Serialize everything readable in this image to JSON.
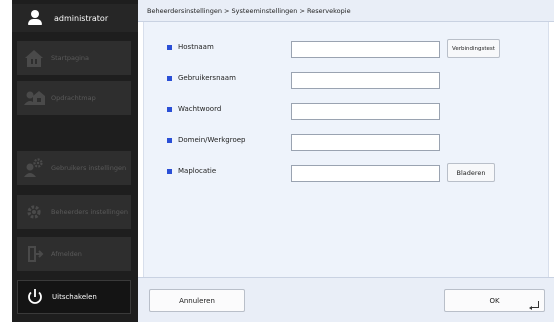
{
  "user": {
    "name": "administrator",
    "icon": "user-icon"
  },
  "sidebar": {
    "items": [
      {
        "label": "Startpagina",
        "icon": "home-icon",
        "enabled": false
      },
      {
        "label": "Opdrachtmap",
        "icon": "job-folder-icon",
        "enabled": false
      },
      {
        "label": "Gebruikers instellingen",
        "icon": "user-settings-icon",
        "enabled": false
      },
      {
        "label": "Beheerders instellingen",
        "icon": "admin-settings-icon",
        "enabled": false
      },
      {
        "label": "Afmelden",
        "icon": "logout-icon",
        "enabled": false
      },
      {
        "label": "Uitschakelen",
        "icon": "power-icon",
        "enabled": true
      }
    ]
  },
  "breadcrumb": "Beheerdersinstellingen > Systeeminstellingen > Reservekopie",
  "form": {
    "fields": [
      {
        "label": "Hostnaam",
        "value": ""
      },
      {
        "label": "Gebruikersnaam",
        "value": ""
      },
      {
        "label": "Wachtwoord",
        "value": ""
      },
      {
        "label": "Domein/Werkgroep",
        "value": ""
      },
      {
        "label": "Maplocatie",
        "value": ""
      }
    ],
    "test_button": "Verbindingstest",
    "browse_button": "Bladeren"
  },
  "footer": {
    "cancel": "Annuleren",
    "ok": "OK"
  },
  "colors": {
    "sidebar": "#1e1e1e",
    "content": "#eef3fb",
    "accent": "#2a4fd6"
  }
}
